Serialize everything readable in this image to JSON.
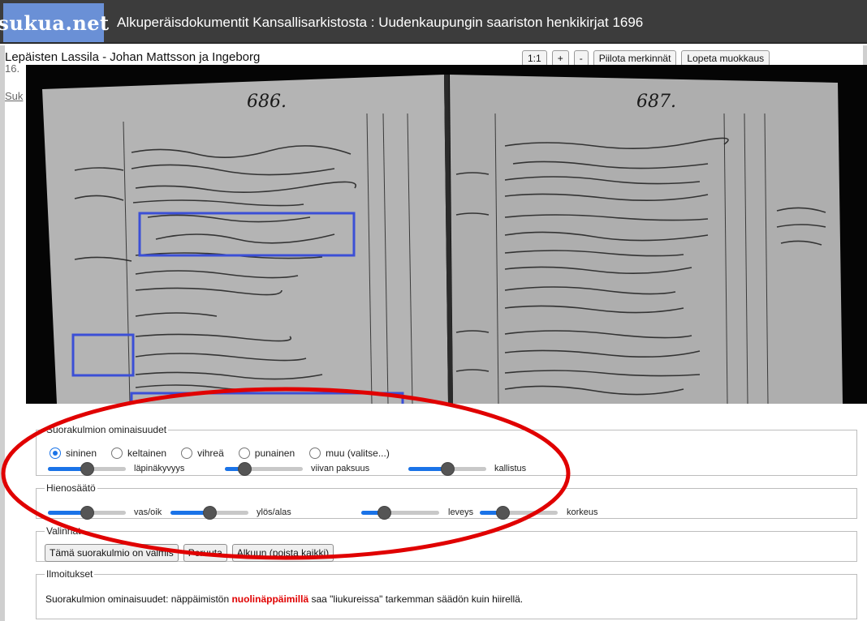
{
  "header": {
    "logo": "sukua.net",
    "title": "Alkuperäisdokumentit Kansallisarkistosta : Uudenkaupungin saariston henkikirjat 1696"
  },
  "page": {
    "heading": "Lepäisten Lassila - Johan Mattsson ja Ingeborg",
    "sub": "16.",
    "sub2": "Suk"
  },
  "toolbar": {
    "zoom_reset": "1:1",
    "zoom_in": "+",
    "zoom_out": "-",
    "hide_marks": "Piilota merkinnät",
    "stop_edit": "Lopeta muokkaus"
  },
  "document": {
    "left_page_number": "686.",
    "right_page_number": "687."
  },
  "properties": {
    "legend": "Suorakulmion ominaisuudet",
    "colors": [
      {
        "label": "sininen",
        "selected": true
      },
      {
        "label": "keltainen",
        "selected": false
      },
      {
        "label": "vihreä",
        "selected": false
      },
      {
        "label": "punainen",
        "selected": false
      },
      {
        "label": "muu (valitse...)",
        "selected": false
      }
    ],
    "sliders": [
      {
        "label": "läpinäkyvyys",
        "value": 0.5
      },
      {
        "label": "viivan paksuus",
        "value": 0.25
      },
      {
        "label": "kallistus",
        "value": 0.5
      }
    ]
  },
  "finetune": {
    "legend": "Hienosäätö",
    "sliders": [
      {
        "label": "vas/oik",
        "value": 0.5
      },
      {
        "label": "ylös/alas",
        "value": 0.5
      },
      {
        "label": "leveys",
        "value": 0.3
      },
      {
        "label": "korkeus",
        "value": 0.3
      }
    ]
  },
  "actions": {
    "legend": "Valinnat",
    "done": "Tämä suorakulmio on valmis",
    "cancel": "Peruuta",
    "reset": "Alkuun (poista kaikki)"
  },
  "notices": {
    "legend": "Ilmoitukset",
    "text_before": "Suorakulmion ominaisuudet: näppäimistön ",
    "text_bold": "nuolinäppäimillä",
    "text_after": " saa \"liukureissa\" tarkemman säädön kuin hiirellä."
  },
  "colors": {
    "accent": "#1a73e8",
    "rect_blue": "#3b4fd6",
    "annotation_red": "#e00000",
    "topbar": "#3c3c3c",
    "logo_bg": "#6a90d6"
  }
}
